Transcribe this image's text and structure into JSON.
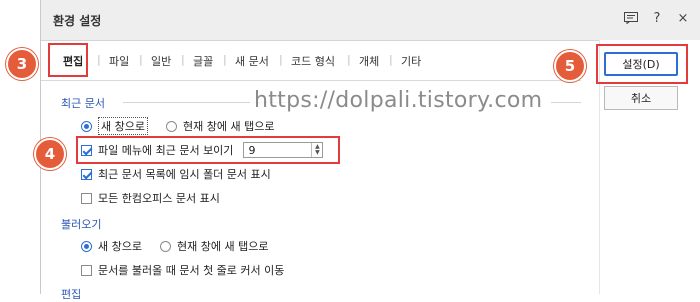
{
  "window": {
    "title": "환경 설정",
    "icons": [
      "memo-icon",
      "help-icon",
      "close-icon"
    ],
    "help_glyph": "?",
    "close_glyph": "×"
  },
  "tabs": [
    {
      "label": "편집",
      "active": true
    },
    {
      "label": "파일"
    },
    {
      "label": "일반"
    },
    {
      "label": "글꼴"
    },
    {
      "label": "새 문서"
    },
    {
      "label": "코드 형식"
    },
    {
      "label": "개체"
    },
    {
      "label": "기타"
    }
  ],
  "sections": {
    "recent": {
      "title": "최근 문서",
      "radio_new_window": "새 창으로",
      "radio_new_tab": "현재 창에 새 탭으로",
      "show_in_file_menu": "파일 메뉴에 최근 문서 보이기",
      "show_count": "9",
      "show_temp_folder": "최근 문서 목록에 임시 폴더 문서 표시",
      "show_all_hancom": "모든 한컴오피스 문서 표시"
    },
    "open": {
      "title": "불러오기",
      "radio_new_window": "새 창으로",
      "radio_new_tab": "현재 창에 새 탭으로",
      "cursor_first_line": "문서를 불러올 때 문서 첫 줄로 커서 이동"
    },
    "edit": {
      "title": "편집"
    }
  },
  "buttons": {
    "ok": "설정(D)",
    "cancel": "취소"
  },
  "watermark": "https://dolpali.tistory.com",
  "badges": [
    "3",
    "4",
    "5"
  ],
  "colors": {
    "accent": "#2b6fd6",
    "highlight": "#e23b3b",
    "badge": "#e55c3a",
    "section_title": "#2b56b7"
  }
}
